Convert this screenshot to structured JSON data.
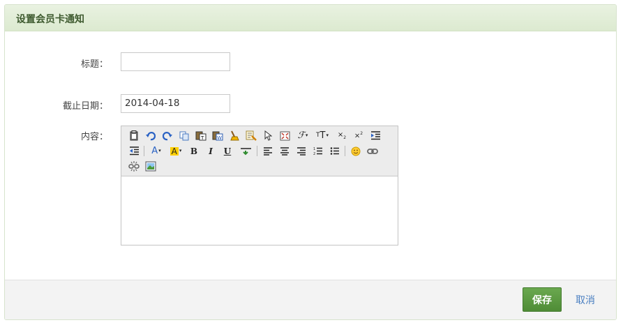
{
  "panel": {
    "title": "设置会员卡通知"
  },
  "form": {
    "title_label": "标题：",
    "title_value": "",
    "deadline_label": "截止日期：",
    "deadline_value": "2014-04-18",
    "content_label": "内容："
  },
  "editor": {
    "toolbar_rows": [
      [
        "paste-icon",
        "undo-icon",
        "redo-icon",
        "copy-icon",
        "paste-text-icon",
        "paste-word-icon",
        "clean-format-icon",
        "format-painter-icon",
        "select-all-icon",
        "fullscreen-icon",
        "font-family-icon",
        "font-size-icon",
        "subscript-icon",
        "superscript-icon",
        "indent-icon"
      ],
      [
        "outdent-icon",
        "font-color-icon",
        "highlight-color-icon",
        "bold-icon",
        "italic-icon",
        "underline-icon",
        "horizontal-rule-icon",
        "align-left-icon",
        "align-center-icon",
        "align-right-icon",
        "ordered-list-icon",
        "unordered-list-icon",
        "emoticon-icon",
        "link-icon"
      ],
      [
        "unlink-icon",
        "image-icon"
      ]
    ],
    "content": ""
  },
  "footer": {
    "save_label": "保存",
    "cancel_label": "取消"
  },
  "colors": {
    "accent": "#5a9a40",
    "header_bg": "#e3eed9",
    "link": "#4a7fc1"
  }
}
